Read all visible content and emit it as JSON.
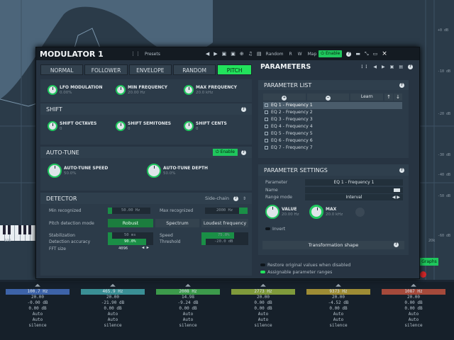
{
  "window": {
    "title": "MODULATOR 1",
    "presets_label": "Presets",
    "random_label": "Random",
    "r_label": "R",
    "w_label": "W",
    "map_label": "Map",
    "enable_label": "Enable",
    "help_label": "?",
    "close_label": "×"
  },
  "tabs": [
    {
      "label": "NORMAL",
      "active": false
    },
    {
      "label": "FOLLOWER",
      "active": false
    },
    {
      "label": "ENVELOPE",
      "active": false
    },
    {
      "label": "RANDOM",
      "active": false
    },
    {
      "label": "PITCH",
      "active": true
    }
  ],
  "top_knobs": [
    {
      "title": "LFO MODULATION",
      "value": "0.00%"
    },
    {
      "title": "MIN FREQUENCY",
      "value": "20.00 Hz"
    },
    {
      "title": "MAX FREQUENCY",
      "value": "20.0 kHz"
    }
  ],
  "shift": {
    "title": "SHIFT",
    "help": "?",
    "knobs": [
      {
        "title": "SHIFT OCTAVES",
        "value": "0"
      },
      {
        "title": "SHIFT SEMITONES",
        "value": "0"
      },
      {
        "title": "SHIFT CENTS",
        "value": "0"
      }
    ]
  },
  "autotune": {
    "title": "AUTO-TUNE",
    "enable_label": "Enable",
    "help": "?",
    "knobs": [
      {
        "title": "AUTO-TUNE SPEED",
        "value": "50.0%"
      },
      {
        "title": "AUTO-TUNE DEPTH",
        "value": "50.0%"
      }
    ]
  },
  "detector": {
    "title": "DETECTOR",
    "sidechain_label": "Side-chain",
    "help": "?",
    "min_recognized_label": "Min recognized",
    "min_recognized_value": "50.00 Hz",
    "max_recognized_label": "Max recognized",
    "max_recognized_value": "2000 Hz",
    "mode_label": "Pitch detection mode",
    "modes": [
      "Robust",
      "Spectrum",
      "Loudest frequency"
    ],
    "stabilization_label": "Stabilization",
    "stabilization_value": "50 ms",
    "accuracy_label": "Detection accuracy",
    "accuracy_value": "90.0%",
    "fft_label": "FFT size",
    "fft_value": "4096",
    "speed_label": "Speed",
    "speed_value": "75.0%",
    "threshold_label": "Threshold",
    "threshold_value": "-20.0 dB"
  },
  "parameters": {
    "title": "PARAMETERS",
    "list_title": "PARAMETER LIST",
    "add_label": "+",
    "remove_label": "−",
    "learn_label": "Learn",
    "up_label": "↑",
    "down_label": "↓",
    "items": [
      {
        "label": "EQ 1 - Frequency 1",
        "selected": true
      },
      {
        "label": "EQ 2 - Frequency 2",
        "selected": false
      },
      {
        "label": "EQ 3 - Frequency 3",
        "selected": false
      },
      {
        "label": "EQ 4 - Frequency 4",
        "selected": false
      },
      {
        "label": "EQ 5 - Frequency 5",
        "selected": false
      },
      {
        "label": "EQ 6 - Frequency 6",
        "selected": false
      },
      {
        "label": "EQ 7 - Frequency 7",
        "selected": false
      }
    ],
    "settings_title": "PARAMETER SETTINGS",
    "parameter_label": "Parameter",
    "parameter_value": "EQ 1 - Frequency 1",
    "name_label": "Name",
    "range_mode_label": "Range mode",
    "range_mode_value": "Interval",
    "value_title": "VALUE",
    "value_value": "20.00 Hz",
    "max_title": "MAX",
    "max_value": "20.0 kHz",
    "invert_label": "Invert",
    "transform_label": "Transformation shape",
    "restore_label": "Restore original values when disabled",
    "assignable_label": "Assignable parameter ranges"
  },
  "background": {
    "axis_labels": [
      "+0 dB",
      "-10 dB",
      "-20 dB",
      "-30 dB",
      "-40 dB",
      "-50 dB",
      "-60 dB"
    ],
    "left_label": "100",
    "right_label": "20k",
    "graphs_label": "Graphs",
    "bands": [
      {
        "freq": "100.7 Hz",
        "q": "20.00",
        "gain": "-0.00 dB",
        "gain2": "0.00 dB",
        "mode1": "Auto",
        "mode2": "Auto",
        "solo": "silence",
        "color": "#3d63a8"
      },
      {
        "freq": "465.9 Hz",
        "q": "20.00",
        "gain": "-21.90 dB",
        "gain2": "0.00 dB",
        "mode1": "Auto",
        "mode2": "Auto",
        "solo": "silence",
        "color": "#3a8f95"
      },
      {
        "freq": "2008 Hz",
        "q": "14.98",
        "gain": "-9.24 dB",
        "gain2": "0.00 dB",
        "mode1": "Auto",
        "mode2": "Auto",
        "solo": "silence",
        "color": "#3c9a4b"
      },
      {
        "freq": "2773 Hz",
        "q": "20.00",
        "gain": "0.00 dB",
        "gain2": "0.00 dB",
        "mode1": "Auto",
        "mode2": "Auto",
        "solo": "silence",
        "color": "#7f9a3b"
      },
      {
        "freq": "9373 Hz",
        "q": "20.00",
        "gain": "-4.52 dB",
        "gain2": "0.00 dB",
        "mode1": "Auto",
        "mode2": "Auto",
        "solo": "silence",
        "color": "#9e8c35"
      },
      {
        "freq": "1087 Hz",
        "q": "20.00",
        "gain": "0.00 dB",
        "gain2": "0.00 dB",
        "mode1": "Auto",
        "mode2": "Auto",
        "solo": "silence",
        "color": "#a54a3b"
      }
    ]
  },
  "colors": {
    "accent_green": "#22e25c",
    "panel": "#2c3b49",
    "window_bg": "#273442",
    "titlebar": "#141b22"
  }
}
